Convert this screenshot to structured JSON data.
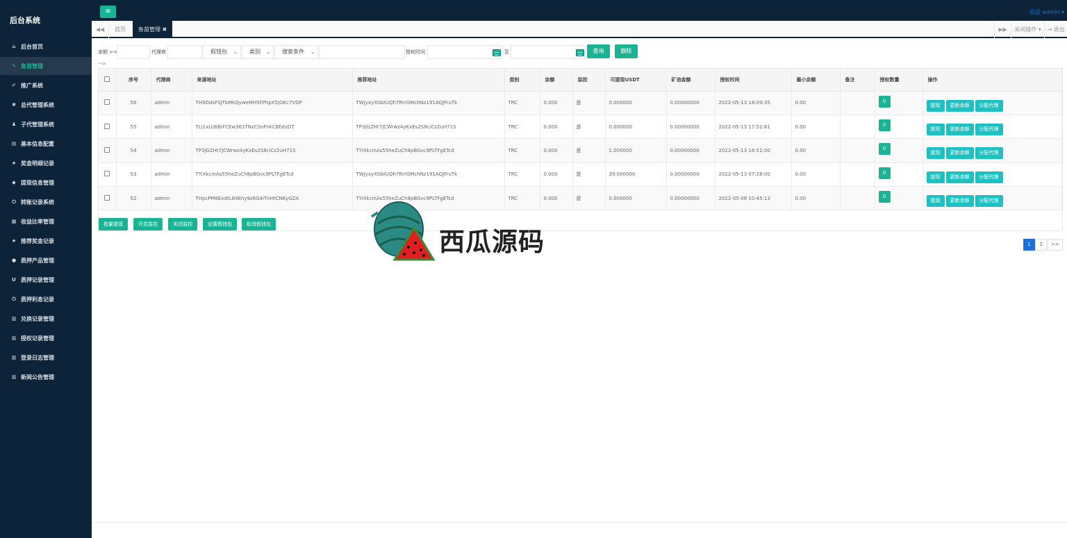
{
  "app": {
    "title": "后台系统"
  },
  "sidebar": {
    "items": [
      {
        "label": "后台首页",
        "icon": "home-icon",
        "glyph": "⌂"
      },
      {
        "label": "鱼苗管理",
        "icon": "wrench-icon",
        "glyph": "✎"
      },
      {
        "label": "推广系统",
        "icon": "edit-icon",
        "glyph": "✐"
      },
      {
        "label": "总代管理系统",
        "icon": "asterisk-icon",
        "glyph": "✱"
      },
      {
        "label": "子代管理系统",
        "icon": "users-icon",
        "glyph": "♟"
      },
      {
        "label": "基本信息配置",
        "icon": "file-icon",
        "glyph": "▤"
      },
      {
        "label": "奖金明细记录",
        "icon": "star-icon",
        "glyph": "★"
      },
      {
        "label": "提现信息管理",
        "icon": "tag-icon",
        "glyph": "◆"
      },
      {
        "label": "转账记录系统",
        "icon": "power-icon",
        "glyph": "⏻"
      },
      {
        "label": "收益比率管理",
        "icon": "calendar-icon",
        "glyph": "▦"
      },
      {
        "label": "推荐奖金记录",
        "icon": "star-icon",
        "glyph": "★"
      },
      {
        "label": "质押产品管理",
        "icon": "comment-icon",
        "glyph": "●"
      },
      {
        "label": "质押记录管理",
        "icon": "magnet-icon",
        "glyph": "U"
      },
      {
        "label": "质押利息记录",
        "icon": "power-icon",
        "glyph": "⏻"
      },
      {
        "label": "兑换记录管理",
        "icon": "book-icon",
        "glyph": "▥"
      },
      {
        "label": "授权记录管理",
        "icon": "book-icon",
        "glyph": "▥"
      },
      {
        "label": "登录日志管理",
        "icon": "book-icon",
        "glyph": "▥"
      },
      {
        "label": "新闻公告管理",
        "icon": "book-icon",
        "glyph": "▥"
      }
    ],
    "active_index": 1
  },
  "topbar": {
    "menu_glyph": "≡",
    "welcome": "欢迎 admin ▾"
  },
  "tabs": {
    "back_glyph": "◀◀",
    "items": [
      {
        "label": "首页"
      },
      {
        "label": "鱼苗管理 ✖"
      }
    ],
    "forward_glyph": "▶▶",
    "close_ops": "关闭操作 ▾",
    "logout": "⇥ 退出"
  },
  "filters": {
    "balance_label": "余额 >=",
    "agent_label": "代理商",
    "wallet_select": "假钱包",
    "type_select": "类别",
    "search_select": "搜索条件",
    "auth_time_label": "授权时间",
    "to_label": "至",
    "query_button": "查询",
    "delete_button": "删除",
    "chevron": "⌄"
  },
  "note": "-->",
  "table": {
    "headers": [
      "序号",
      "代理商",
      "来源地址",
      "推荐地址",
      "类别",
      "余额",
      "监控",
      "可提现USDT",
      "矿池金额",
      "授权时间",
      "最小余额",
      "备注",
      "授权数量",
      "操作"
    ],
    "rows": [
      {
        "id": "56",
        "agent": "admin",
        "source": "TH9DdsFSJTbMkQyweMH5FPhpX5jGKc7VDP",
        "referrer": "TWJyxyXGblUQh7RrrGMchNz191AQJFruTk",
        "type": "TRC",
        "balance": "0.000",
        "monitor": "是",
        "usdt": "0.000000",
        "pool": "0.00000000",
        "time": "2022-05-13 18:09:35",
        "min_balance": "0.00",
        "note": "",
        "auth_count": "0"
      },
      {
        "id": "55",
        "agent": "admin",
        "source": "TLi1xLU6BiFCEw361TNzCSoFnkCBfstzDT",
        "referrer": "TP3jGZHt7JCWrwz4yKxEs2S8ciCz2uH71S",
        "type": "TRC",
        "balance": "0.000",
        "monitor": "是",
        "usdt": "0.000000",
        "pool": "0.00000000",
        "time": "2022-05-13 17:52:81",
        "min_balance": "0.00",
        "note": "",
        "auth_count": "0"
      },
      {
        "id": "54",
        "agent": "admin",
        "source": "TP3jGZHt7JCWrwz4yKxEs2S8ciCz2uH71S",
        "referrer": "TYiXkcinAs55heZuCh8pBGvc9PLTFgETcd",
        "type": "TRC",
        "balance": "0.000",
        "monitor": "是",
        "usdt": "1.000000",
        "pool": "0.00000000",
        "time": "2022-05-13 16:51:00",
        "min_balance": "0.00",
        "note": "",
        "auth_count": "0"
      },
      {
        "id": "53",
        "agent": "admin",
        "source": "TYiXkcinAs55heZuCh8pBGvc9PLTFgETcd",
        "referrer": "TWJyxyXGblUQh7RrrGMchNz191AQJFruTk",
        "type": "TRC",
        "balance": "0.000",
        "monitor": "是",
        "usdt": "39.000000",
        "pool": "0.00000000",
        "time": "2022-05-13 07:28:00",
        "min_balance": "0.00",
        "note": "",
        "auth_count": "0"
      },
      {
        "id": "52",
        "agent": "admin",
        "source": "THpcPM8ExdtL64Eny9z6G4iTnHtCNKyGZA",
        "referrer": "TYiXkcinAs55heZuCh8pBGvc9PLTFgETcd",
        "type": "TRC",
        "balance": "0.000",
        "monitor": "是",
        "usdt": "0.000000",
        "pool": "0.00000000",
        "time": "2022-05-08 10:45:13",
        "min_balance": "0.00",
        "note": "",
        "auth_count": "0"
      }
    ],
    "row_actions": [
      "提现",
      "更新余额",
      "分配代理"
    ]
  },
  "bulk_actions": [
    "批量提现",
    "开启监控",
    "关闭监控",
    "设置假钱包",
    "取消假钱包"
  ],
  "pagination": {
    "pages": [
      "1",
      "2",
      ">>"
    ],
    "current": "1"
  },
  "watermark": {
    "text": "西瓜源码"
  },
  "colors": {
    "sidebar_bg": "#0d2339",
    "accent": "#1ab394",
    "action_button": "#1ec1c1",
    "pager_active": "#1e6fd9",
    "link_blue": "#1e6fc9"
  }
}
